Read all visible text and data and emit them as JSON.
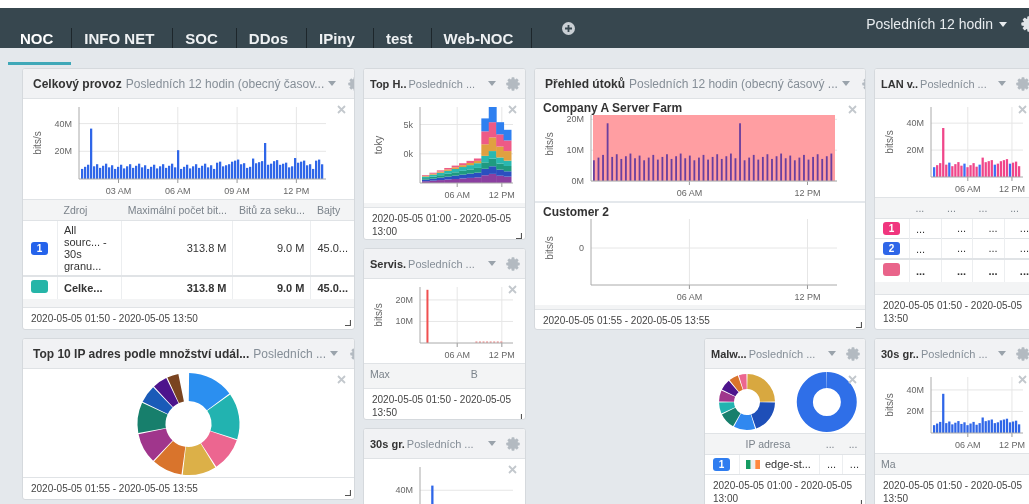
{
  "tabs": [
    {
      "label": "NOC",
      "selected": true
    },
    {
      "label": "INFO NET",
      "selected": false
    },
    {
      "label": "SOC",
      "selected": false
    },
    {
      "label": "DDos",
      "selected": false
    },
    {
      "label": "IPiny",
      "selected": false
    },
    {
      "label": "test",
      "selected": false
    },
    {
      "label": "Web-NOC",
      "selected": false
    }
  ],
  "time_range": "Posledních 12 hodin",
  "columns": [
    {
      "widgets": [
        {
          "title": "Celkový provoz",
          "range": "Posledních 12 hodin (obecný časov...",
          "body": {
            "kind": "chart",
            "charts": [
              {
                "kind": "bars",
                "y_label": "bits/s",
                "y_ticks": [
                  "40M",
                  "20M"
                ],
                "x_ticks": [
                  "03 AM",
                  "06 AM",
                  "09 AM",
                  "12 PM"
                ]
              }
            ]
          },
          "table": {
            "columns": [
              "Zdroj",
              "Maximální počet bit...",
              "Bitů za seku...",
              "Bajty"
            ],
            "rows": [
              {
                "kind": "series",
                "badge": "1",
                "color": "#2563eb",
                "bold": false,
                "cells": [
                  "All sourc... - 30s granu...",
                  "313.8 M",
                  "9.0 M",
                  "45.0..."
                ]
              },
              {
                "kind": "series",
                "color": "#26b5a8",
                "bold": true,
                "cells": [
                  "Celke...",
                  "313.8 M",
                  "9.0 M",
                  "45.0..."
                ]
              }
            ]
          },
          "footer": "2020-05-05 01:50 - 2020-05-05 13:50"
        },
        {
          "title": "Top 10 IP adres podle množství udál...",
          "range": "Posledních ...",
          "body": {
            "kind": "donut"
          },
          "footer": "2020-05-05 01:55 - 2020-05-05 13:55"
        }
      ]
    },
    {
      "widgets": [
        {
          "title": "Top H..",
          "range": "Posledních ...",
          "body": {
            "kind": "chart",
            "charts": [
              {
                "kind": "stacked",
                "y_label": "toky",
                "y_ticks": [
                  "5k",
                  "0k"
                ],
                "x_ticks": [
                  "06 AM",
                  "12 PM"
                ]
              }
            ]
          },
          "footer": "2020-05-05 01:00 - 2020-05-05 13:00"
        },
        {
          "title": "Servis.",
          "range": "Posledních ...",
          "body": {
            "kind": "chart",
            "charts": [
              {
                "kind": "spike",
                "y_label": "bits/s",
                "y_ticks": [
                  "20M",
                  "10M"
                ],
                "x_ticks": [
                  "06 AM",
                  "12 PM"
                ]
              }
            ]
          },
          "table": {
            "columns": [
              "Max",
              "B"
            ]
          },
          "footer": "2020-05-05 01:50 - 2020-05-05 13:50"
        },
        {
          "title": "30s gr.",
          "range": "Posledních ...",
          "body": {
            "kind": "chart",
            "charts": [
              {
                "kind": "bars",
                "y_ticks": [
                  "40M"
                ]
              }
            ]
          }
        }
      ]
    },
    {
      "widgets": [
        {
          "title": "Přehled útoků",
          "range": "Posledních 12 hodin (obecný časový ...",
          "body": {
            "kind": "chart",
            "charts": [
              {
                "kind": "band",
                "title": "Company A Server Farm",
                "y_label": "bits/s",
                "y_ticks": [
                  "20M",
                  "10M",
                  "0M"
                ],
                "x_ticks": [
                  "06 AM",
                  "12 PM"
                ]
              },
              {
                "kind": "empty",
                "title": "Customer 2",
                "y_label": "bits/s",
                "y_ticks": [
                  "0"
                ],
                "x_ticks": [
                  "06 AM",
                  "12 PM"
                ]
              }
            ]
          },
          "footer": "2020-05-05 01:55 - 2020-05-05 13:55"
        },
        {
          "title": "Malw...",
          "range": "Posledních ...",
          "body": {
            "kind": "double_donut"
          },
          "table": {
            "columns": [
              "IP adresa",
              "...",
              "..."
            ],
            "rows": [
              {
                "kind": "host",
                "badge": "1",
                "color": "#2f7df0",
                "bold": false,
                "cells": [
                  "edge-st...",
                  "...",
                  "..."
                ]
              }
            ]
          },
          "footer": "2020-05-05 01:00 - 2020-05-05 13:00"
        }
      ]
    },
    {
      "widgets": [
        {
          "title": "LAN v..",
          "range": "Posledních ...",
          "body": {
            "kind": "chart",
            "charts": [
              {
                "kind": "overlay",
                "y_label": "bits/s",
                "y_ticks": [
                  "40M",
                  "20M"
                ],
                "x_ticks": [
                  "06 AM",
                  "12 PM"
                ]
              }
            ]
          },
          "table": {
            "columns": [
              "...",
              "...",
              "...",
              "..."
            ],
            "rows": [
              {
                "kind": "series",
                "badge": "1",
                "color": "#f0357e",
                "bold": false,
                "cells": [
                  "...",
                  "...",
                  "...",
                  "..."
                ]
              },
              {
                "kind": "series",
                "badge": "2",
                "color": "#2f66e8",
                "bold": false,
                "cells": [
                  "...",
                  "...",
                  "...",
                  "..."
                ]
              },
              {
                "kind": "series",
                "color": "#e9648a",
                "bold": true,
                "cells": [
                  "...",
                  "...",
                  "...",
                  "..."
                ]
              }
            ]
          },
          "footer": "2020-05-05 01:50 - 2020-05-05 13:50"
        },
        {
          "title": "30s gr..",
          "range": "Posledních ...",
          "body": {
            "kind": "chart",
            "charts": [
              {
                "kind": "bars",
                "y_label": "bits/s",
                "y_ticks": [
                  "40M",
                  "20M"
                ],
                "x_ticks": [
                  "06 AM",
                  "12 PM"
                ]
              }
            ]
          },
          "table": {
            "columns": [
              "Ma"
            ]
          },
          "footer": "2020-05-05 01:50 - 2020-05-05 13:50"
        }
      ]
    }
  ]
}
